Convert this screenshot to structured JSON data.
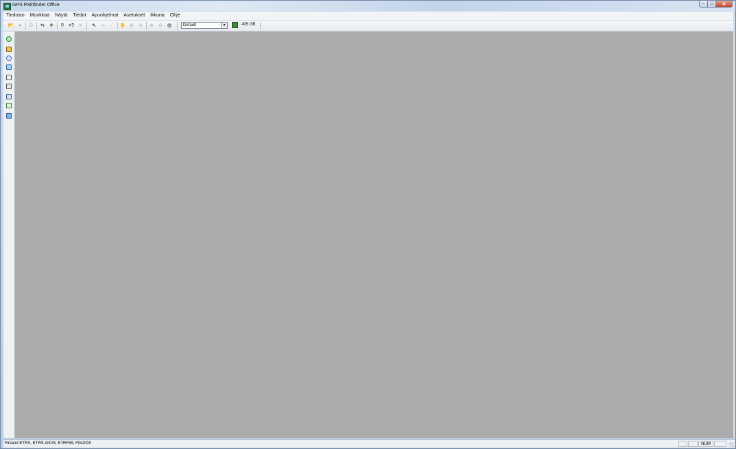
{
  "window": {
    "title": "GPS Pathfinder Office",
    "close_symbol": "✕",
    "minimize_symbol": "–",
    "maximize_symbol": "□"
  },
  "menu": [
    "Tiedosto",
    "Muokkaa",
    "Näytä",
    "Tiedot",
    "Apuohjelmat",
    "Asetukset",
    "Ikkuna",
    "Ohje"
  ],
  "toolbar": {
    "style_select_value": "Default",
    "style_select_arrow": "▼",
    "disk_space": "405 GB",
    "buttons": [
      {
        "name": "open-icon",
        "glyph": "📂"
      },
      {
        "name": "save-icon",
        "glyph": "▪"
      },
      {
        "name": "print-icon",
        "glyph": "⎙"
      },
      {
        "name": "data-transfer-icon",
        "glyph": "⇆"
      },
      {
        "name": "differential-correction-icon",
        "glyph": "✚"
      },
      {
        "name": "feature-properties-icon",
        "glyph": "⚲"
      },
      {
        "name": "help-pointer-icon",
        "glyph": "+?"
      },
      {
        "name": "tools-icon",
        "glyph": "✕"
      },
      {
        "name": "select-arrow-icon",
        "glyph": "↖"
      },
      {
        "name": "measure-icon",
        "glyph": "═"
      },
      {
        "name": "pen-icon",
        "glyph": "⟋"
      },
      {
        "name": "pan-hand-icon",
        "glyph": "✋"
      },
      {
        "name": "zoom-in-icon",
        "glyph": "⊕"
      },
      {
        "name": "zoom-out-icon",
        "glyph": "⊖"
      },
      {
        "name": "zoom-extents-icon",
        "glyph": "⊕"
      },
      {
        "name": "zoom-previous-icon",
        "glyph": "⊖"
      },
      {
        "name": "globe-icon",
        "glyph": "◎"
      }
    ]
  },
  "sidebar": [
    {
      "name": "project-icon",
      "color": "#1c8a3a"
    },
    {
      "name": "feature-data-icon",
      "color": "#c58a12"
    },
    {
      "name": "satellite-icon",
      "color": "#3b6fc7"
    },
    {
      "name": "import-icon",
      "color": "#2f6fb0"
    },
    {
      "name": "export-icon",
      "color": "#555555"
    },
    {
      "name": "map-icon",
      "color": "#555555"
    },
    {
      "name": "time-line-icon",
      "color": "#355d8a"
    },
    {
      "name": "quickplan-icon",
      "color": "#3b7a3b"
    },
    {
      "name": "data-dictionary-icon",
      "color": "#2c5aa0"
    }
  ],
  "status": {
    "coordinate_system": "Finland ETRS, ETRS-GK25, ETRF89, FIN2000",
    "num_indicator": "NUM"
  },
  "colors": {
    "workspace": "#ababab"
  }
}
